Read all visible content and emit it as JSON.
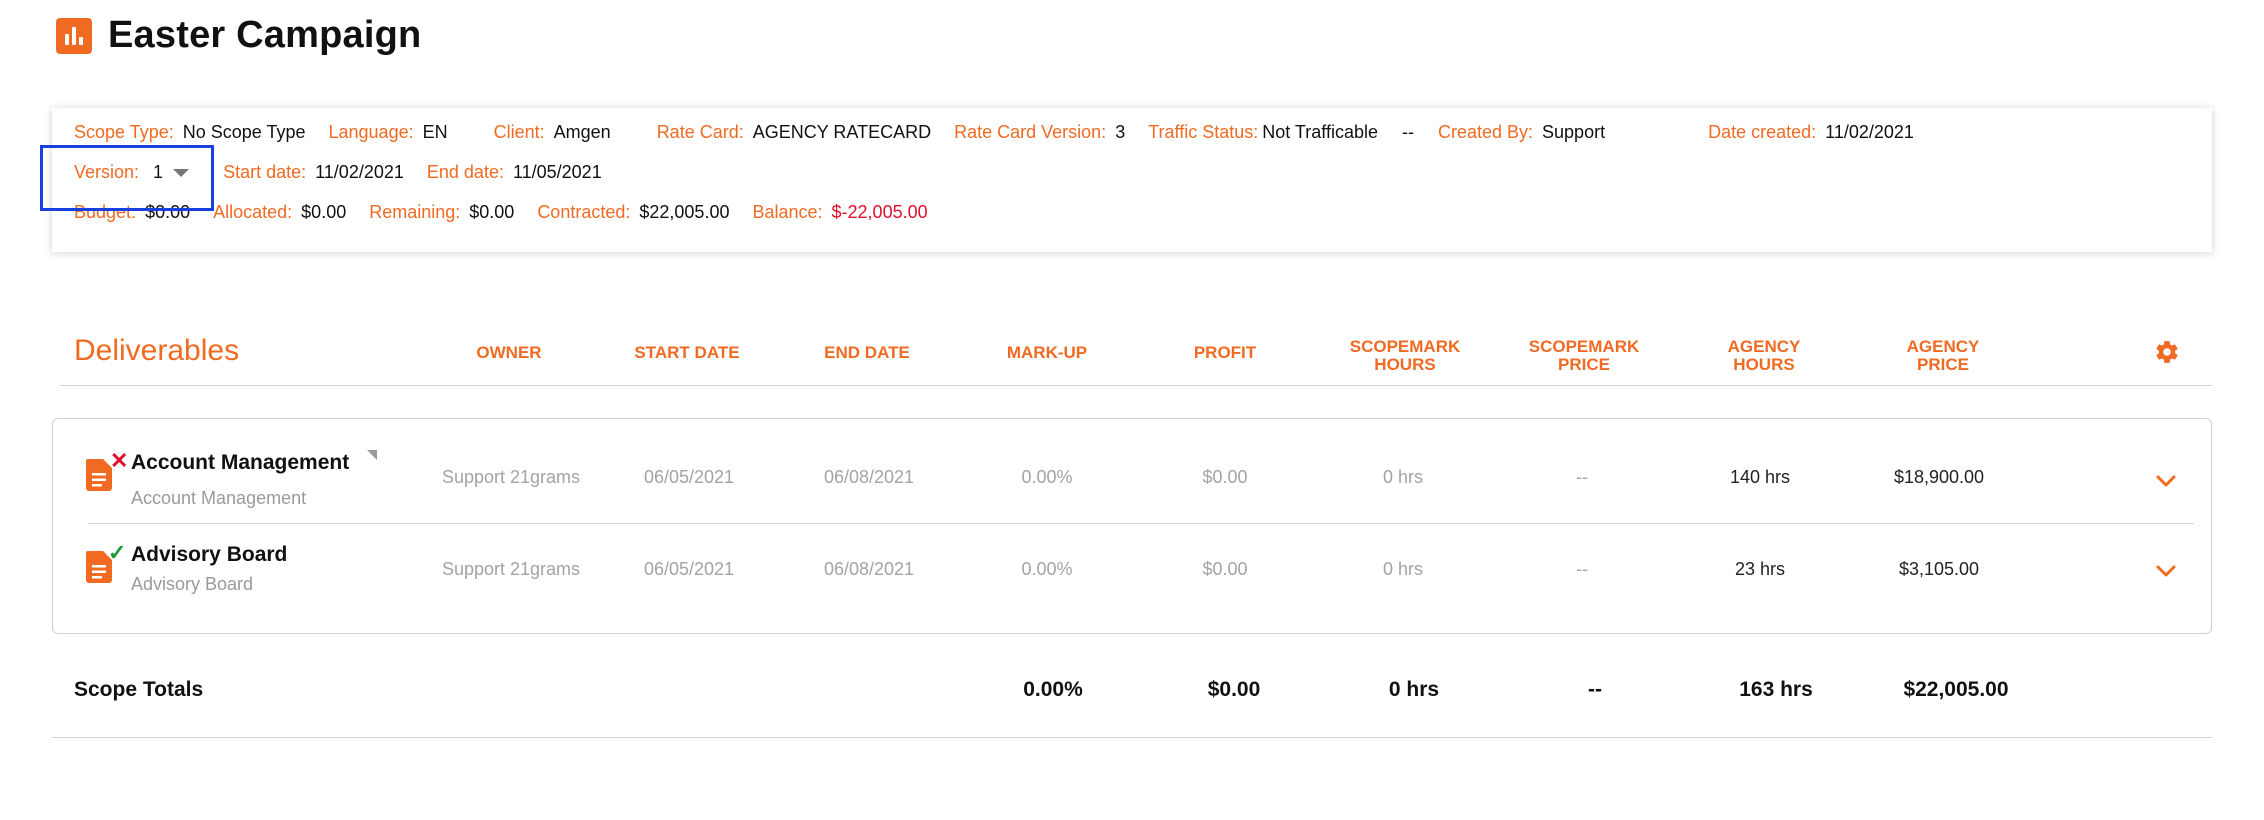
{
  "header": {
    "title": "Easter Campaign"
  },
  "info": {
    "scope_type": {
      "label": "Scope Type:",
      "value": "No Scope Type"
    },
    "language": {
      "label": "Language:",
      "value": "EN"
    },
    "client": {
      "label": "Client:",
      "value": "Amgen"
    },
    "rate_card": {
      "label": "Rate Card:",
      "value": "AGENCY RATECARD"
    },
    "rate_card_version": {
      "label": "Rate Card Version:",
      "value": "3"
    },
    "traffic_status": {
      "label": "Traffic Status:",
      "value": "Not Trafficable",
      "extra": "--"
    },
    "created_by": {
      "label": "Created By:",
      "value": "Support"
    },
    "date_created": {
      "label": "Date created:",
      "value": "11/02/2021"
    },
    "version": {
      "label": "Version:",
      "value": "1"
    },
    "start_date": {
      "label": "Start date:",
      "value": "11/02/2021"
    },
    "end_date": {
      "label": "End date:",
      "value": "11/05/2021"
    },
    "budget": {
      "label": "Budget:",
      "value": "$0.00"
    },
    "allocated": {
      "label": "Allocated:",
      "value": "$0.00"
    },
    "remaining": {
      "label": "Remaining:",
      "value": "$0.00"
    },
    "contracted": {
      "label": "Contracted:",
      "value": "$22,005.00"
    },
    "balance": {
      "label": "Balance:",
      "value": "$-22,005.00"
    }
  },
  "deliverables": {
    "title": "Deliverables",
    "columns": {
      "owner": "OWNER",
      "start_date": "START DATE",
      "end_date": "END DATE",
      "markup": "MARK-UP",
      "profit": "PROFIT",
      "scopemark_hours_1": "SCOPEMARK",
      "scopemark_hours_2": "HOURS",
      "scopemark_price_1": "SCOPEMARK",
      "scopemark_price_2": "PRICE",
      "agency_hours_1": "AGENCY",
      "agency_hours_2": "HOURS",
      "agency_price_1": "AGENCY",
      "agency_price_2": "PRICE"
    },
    "rows": [
      {
        "name": "Account Management",
        "subtitle": "Account Management",
        "status_mark": "✕",
        "owner": "Support 21grams",
        "start_date": "06/05/2021",
        "end_date": "06/08/2021",
        "markup": "0.00%",
        "profit": "$0.00",
        "scopemark_hours": "0 hrs",
        "scopemark_price": "--",
        "agency_hours": "140 hrs",
        "agency_price": "$18,900.00"
      },
      {
        "name": "Advisory Board",
        "subtitle": "Advisory Board",
        "status_mark": "✓",
        "owner": "Support 21grams",
        "start_date": "06/05/2021",
        "end_date": "06/08/2021",
        "markup": "0.00%",
        "profit": "$0.00",
        "scopemark_hours": "0 hrs",
        "scopemark_price": "--",
        "agency_hours": "23 hrs",
        "agency_price": "$3,105.00"
      }
    ]
  },
  "totals": {
    "label": "Scope Totals",
    "markup": "0.00%",
    "profit": "$0.00",
    "scopemark_hours": "0 hrs",
    "scopemark_price": "--",
    "agency_hours": "163 hrs",
    "agency_price": "$22,005.00"
  },
  "colors": {
    "accent": "#f06a22",
    "negative": "#e0102c",
    "selection": "#1a3fe0",
    "success": "#1f9a3a"
  },
  "icons": {
    "logo": "bar-chart-icon",
    "settings": "gear-icon",
    "document": "document-icon",
    "expand": "chevron-down-icon"
  }
}
